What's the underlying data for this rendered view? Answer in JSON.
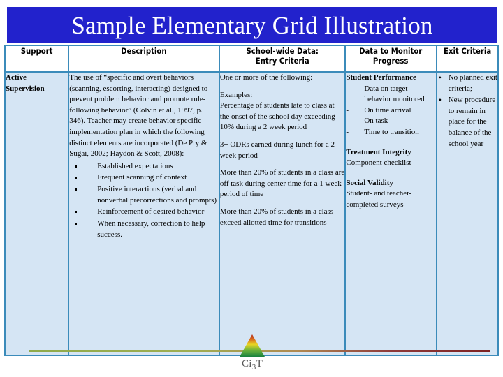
{
  "title": {
    "text": "Sample Elementary Grid Illustration",
    "banner_color": "#2222CC",
    "text_color": "#FFFFFF"
  },
  "table": {
    "border_color": "#3B8BBA",
    "body_bg": "#D5E5F4",
    "headers": [
      "Support",
      "Description",
      "School-wide Data:\nEntry Criteria",
      "Data to Monitor\nProgress",
      "Exit Criteria"
    ],
    "header_support": "Support",
    "header_description": "Description",
    "header_schoolwide_line1": "School-wide Data:",
    "header_schoolwide_line2": "Entry Criteria",
    "header_monitor_line1": "Data to Monitor",
    "header_monitor_line2": "Progress",
    "header_exit": "Exit Criteria",
    "row": {
      "support": {
        "label_line1": "Active",
        "label_line2": "Supervision"
      },
      "description": {
        "paragraph": "The use of “specific and overt behaviors (scanning, escorting, interacting) designed to prevent problem behavior and promote rule-following behavior” (Colvin et al., 1997, p. 346).  Teacher may create behavior specific implementation plan in which the following distinct elements are incorporated (De Pry & Sugai, 2002; Haydon & Scott, 2008):",
        "bullets": [
          "Established expectations",
          "Frequent scanning of context",
          "Positive interactions (verbal and nonverbal precorrections and prompts)",
          "Reinforcement of desired behavior",
          "When necessary, correction to help success."
        ]
      },
      "schoolwide_data": {
        "intro": "One or more of the following:",
        "examples_label": "Examples:",
        "example_1": "Percentage of students late to class at the onset of the school day exceeding 10% during a 2 week period",
        "example_2": "3+ ODRs earned during lunch for a 2 week period",
        "example_3": "More than 20% of students in a class are off task during center time for a 1 week period of time",
        "example_4": "More than 20% of students in a class exceed allotted time for transitions"
      },
      "data_to_monitor": {
        "student_performance_heading": "Student Performance",
        "student_performance_note": "Data on target behavior monitored",
        "student_performance_items": [
          "On time arrival",
          "On task",
          "Time to transition"
        ],
        "treatment_integrity_heading": "Treatment Integrity",
        "treatment_integrity_text": "Component checklist",
        "social_validity_heading": "Social Validity",
        "social_validity_text": "Student- and teacher-completed surveys"
      },
      "exit_criteria": {
        "bullets": [
          "No planned exit criteria;",
          "New procedure to remain in place for the balance of the school year"
        ]
      }
    }
  },
  "footer": {
    "logo_caption_main": "Ci",
    "logo_caption_sub": "3",
    "logo_caption_tail": "T",
    "logo_colors": {
      "top": "#C0392B",
      "middle": "#E8D52F",
      "bottom": "#1E8449"
    },
    "rule_left_color": "#8FAA4A",
    "rule_right_color": "#7D2222"
  }
}
